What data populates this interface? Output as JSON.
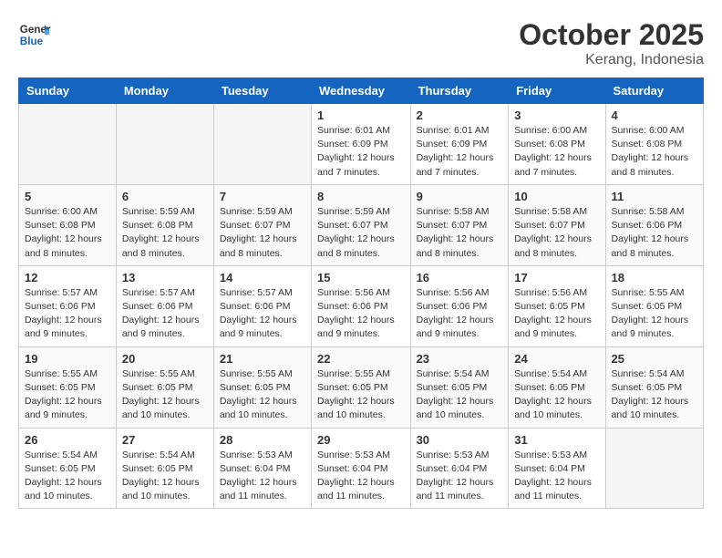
{
  "header": {
    "logo_line1": "General",
    "logo_line2": "Blue",
    "month_year": "October 2025",
    "location": "Kerang, Indonesia"
  },
  "weekdays": [
    "Sunday",
    "Monday",
    "Tuesday",
    "Wednesday",
    "Thursday",
    "Friday",
    "Saturday"
  ],
  "weeks": [
    [
      {
        "day": "",
        "info": ""
      },
      {
        "day": "",
        "info": ""
      },
      {
        "day": "",
        "info": ""
      },
      {
        "day": "1",
        "info": "Sunrise: 6:01 AM\nSunset: 6:09 PM\nDaylight: 12 hours\nand 7 minutes."
      },
      {
        "day": "2",
        "info": "Sunrise: 6:01 AM\nSunset: 6:09 PM\nDaylight: 12 hours\nand 7 minutes."
      },
      {
        "day": "3",
        "info": "Sunrise: 6:00 AM\nSunset: 6:08 PM\nDaylight: 12 hours\nand 7 minutes."
      },
      {
        "day": "4",
        "info": "Sunrise: 6:00 AM\nSunset: 6:08 PM\nDaylight: 12 hours\nand 8 minutes."
      }
    ],
    [
      {
        "day": "5",
        "info": "Sunrise: 6:00 AM\nSunset: 6:08 PM\nDaylight: 12 hours\nand 8 minutes."
      },
      {
        "day": "6",
        "info": "Sunrise: 5:59 AM\nSunset: 6:08 PM\nDaylight: 12 hours\nand 8 minutes."
      },
      {
        "day": "7",
        "info": "Sunrise: 5:59 AM\nSunset: 6:07 PM\nDaylight: 12 hours\nand 8 minutes."
      },
      {
        "day": "8",
        "info": "Sunrise: 5:59 AM\nSunset: 6:07 PM\nDaylight: 12 hours\nand 8 minutes."
      },
      {
        "day": "9",
        "info": "Sunrise: 5:58 AM\nSunset: 6:07 PM\nDaylight: 12 hours\nand 8 minutes."
      },
      {
        "day": "10",
        "info": "Sunrise: 5:58 AM\nSunset: 6:07 PM\nDaylight: 12 hours\nand 8 minutes."
      },
      {
        "day": "11",
        "info": "Sunrise: 5:58 AM\nSunset: 6:06 PM\nDaylight: 12 hours\nand 8 minutes."
      }
    ],
    [
      {
        "day": "12",
        "info": "Sunrise: 5:57 AM\nSunset: 6:06 PM\nDaylight: 12 hours\nand 9 minutes."
      },
      {
        "day": "13",
        "info": "Sunrise: 5:57 AM\nSunset: 6:06 PM\nDaylight: 12 hours\nand 9 minutes."
      },
      {
        "day": "14",
        "info": "Sunrise: 5:57 AM\nSunset: 6:06 PM\nDaylight: 12 hours\nand 9 minutes."
      },
      {
        "day": "15",
        "info": "Sunrise: 5:56 AM\nSunset: 6:06 PM\nDaylight: 12 hours\nand 9 minutes."
      },
      {
        "day": "16",
        "info": "Sunrise: 5:56 AM\nSunset: 6:06 PM\nDaylight: 12 hours\nand 9 minutes."
      },
      {
        "day": "17",
        "info": "Sunrise: 5:56 AM\nSunset: 6:05 PM\nDaylight: 12 hours\nand 9 minutes."
      },
      {
        "day": "18",
        "info": "Sunrise: 5:55 AM\nSunset: 6:05 PM\nDaylight: 12 hours\nand 9 minutes."
      }
    ],
    [
      {
        "day": "19",
        "info": "Sunrise: 5:55 AM\nSunset: 6:05 PM\nDaylight: 12 hours\nand 9 minutes."
      },
      {
        "day": "20",
        "info": "Sunrise: 5:55 AM\nSunset: 6:05 PM\nDaylight: 12 hours\nand 10 minutes."
      },
      {
        "day": "21",
        "info": "Sunrise: 5:55 AM\nSunset: 6:05 PM\nDaylight: 12 hours\nand 10 minutes."
      },
      {
        "day": "22",
        "info": "Sunrise: 5:55 AM\nSunset: 6:05 PM\nDaylight: 12 hours\nand 10 minutes."
      },
      {
        "day": "23",
        "info": "Sunrise: 5:54 AM\nSunset: 6:05 PM\nDaylight: 12 hours\nand 10 minutes."
      },
      {
        "day": "24",
        "info": "Sunrise: 5:54 AM\nSunset: 6:05 PM\nDaylight: 12 hours\nand 10 minutes."
      },
      {
        "day": "25",
        "info": "Sunrise: 5:54 AM\nSunset: 6:05 PM\nDaylight: 12 hours\nand 10 minutes."
      }
    ],
    [
      {
        "day": "26",
        "info": "Sunrise: 5:54 AM\nSunset: 6:05 PM\nDaylight: 12 hours\nand 10 minutes."
      },
      {
        "day": "27",
        "info": "Sunrise: 5:54 AM\nSunset: 6:05 PM\nDaylight: 12 hours\nand 10 minutes."
      },
      {
        "day": "28",
        "info": "Sunrise: 5:53 AM\nSunset: 6:04 PM\nDaylight: 12 hours\nand 11 minutes."
      },
      {
        "day": "29",
        "info": "Sunrise: 5:53 AM\nSunset: 6:04 PM\nDaylight: 12 hours\nand 11 minutes."
      },
      {
        "day": "30",
        "info": "Sunrise: 5:53 AM\nSunset: 6:04 PM\nDaylight: 12 hours\nand 11 minutes."
      },
      {
        "day": "31",
        "info": "Sunrise: 5:53 AM\nSunset: 6:04 PM\nDaylight: 12 hours\nand 11 minutes."
      },
      {
        "day": "",
        "info": ""
      }
    ]
  ]
}
